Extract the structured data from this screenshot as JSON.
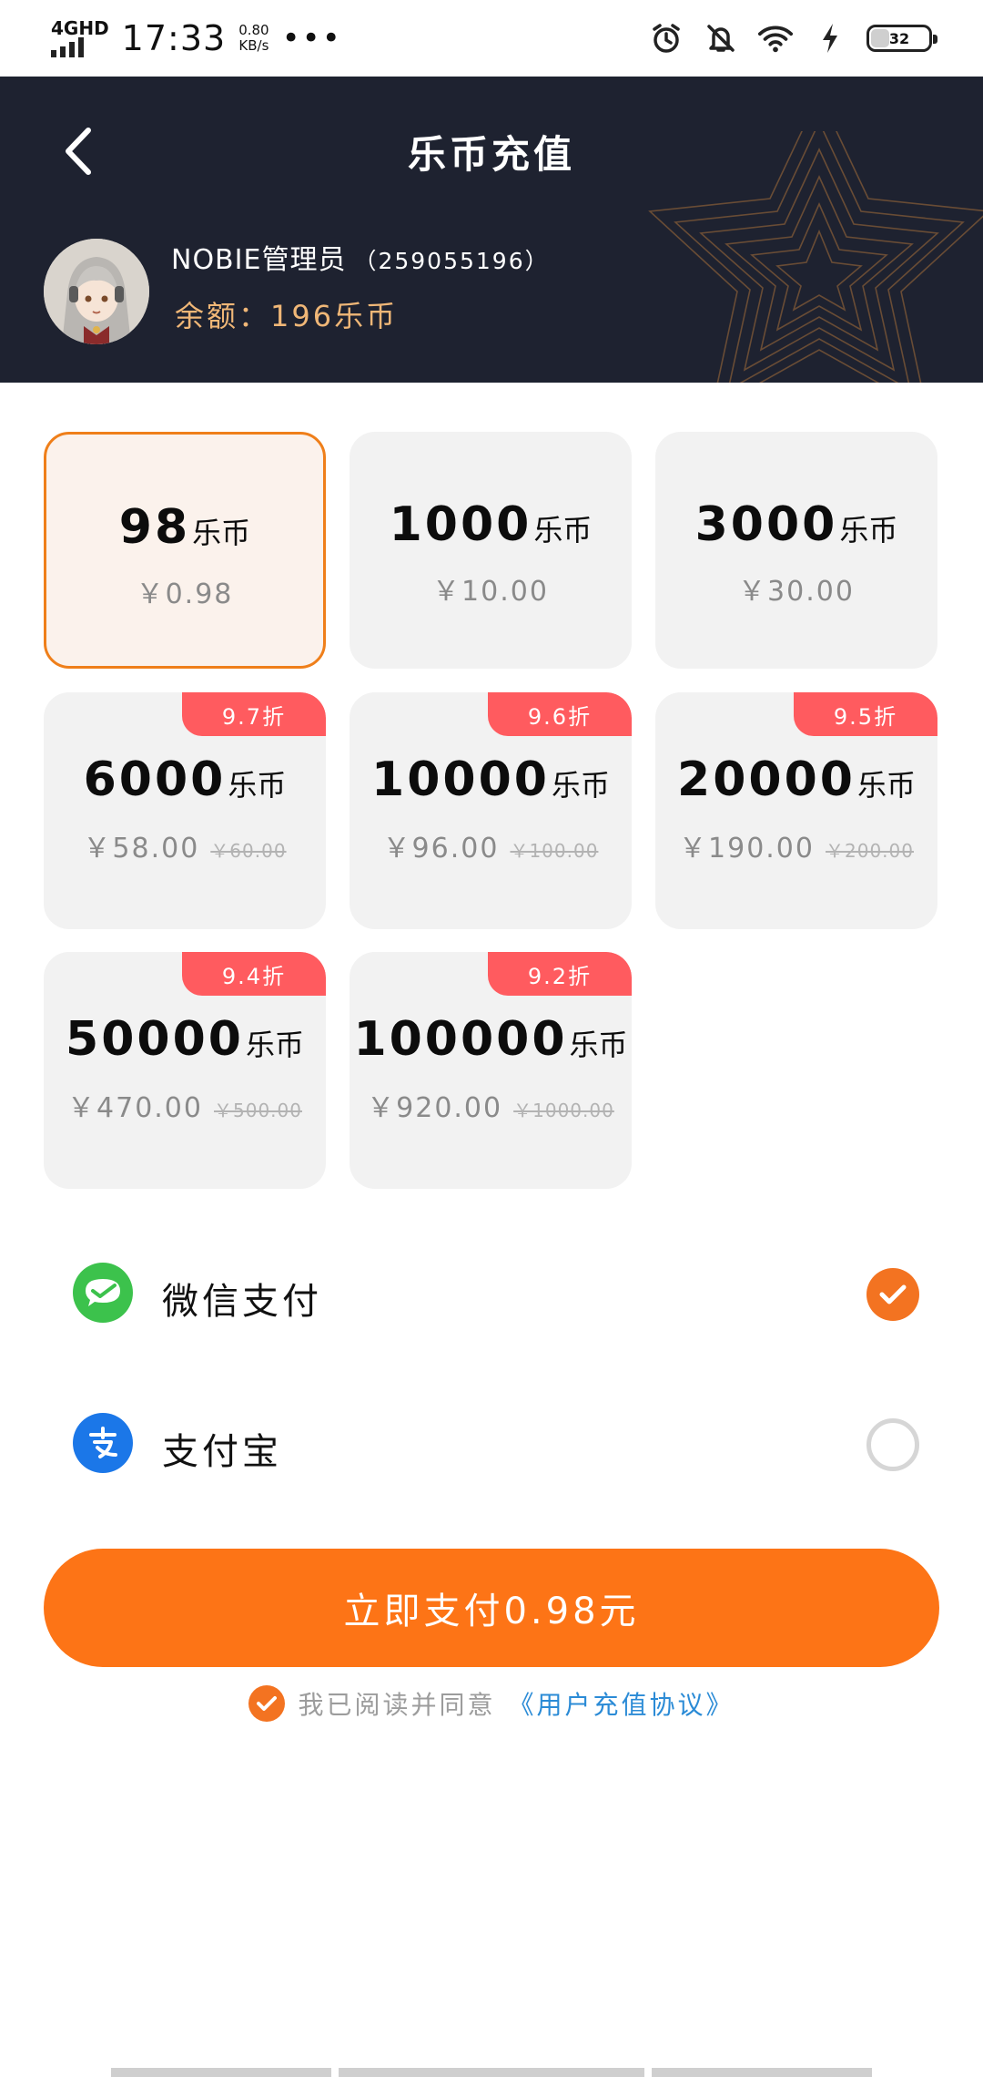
{
  "status_bar": {
    "network": "4GHD",
    "time": "17:33",
    "speed_value": "0.80",
    "speed_unit": "KB/s",
    "more": "•••",
    "battery": "32",
    "icons": [
      "alarm-icon",
      "mute-icon",
      "wifi-icon",
      "charging-icon",
      "battery-icon"
    ]
  },
  "header": {
    "title": "乐币充值",
    "back_icon": "back-arrow-icon",
    "user_name": "NOBIE管理员",
    "user_id": "（259055196）",
    "balance": "余额：196乐币",
    "avatar": "anime-girl-avatar"
  },
  "packages": [
    {
      "amount": "98",
      "unit": "乐币",
      "price": "￥0.98",
      "original": "",
      "badge": "",
      "selected": true
    },
    {
      "amount": "1000",
      "unit": "乐币",
      "price": "￥10.00",
      "original": "",
      "badge": "",
      "selected": false
    },
    {
      "amount": "3000",
      "unit": "乐币",
      "price": "￥30.00",
      "original": "",
      "badge": "",
      "selected": false
    },
    {
      "amount": "6000",
      "unit": "乐币",
      "price": "￥58.00",
      "original": "￥60.00",
      "badge": "9.7折",
      "selected": false
    },
    {
      "amount": "10000",
      "unit": "乐币",
      "price": "￥96.00",
      "original": "￥100.00",
      "badge": "9.6折",
      "selected": false
    },
    {
      "amount": "20000",
      "unit": "乐币",
      "price": "￥190.00",
      "original": "￥200.00",
      "badge": "9.5折",
      "selected": false
    },
    {
      "amount": "50000",
      "unit": "乐币",
      "price": "￥470.00",
      "original": "￥500.00",
      "badge": "9.4折",
      "selected": false
    },
    {
      "amount": "100000",
      "unit": "乐币",
      "price": "￥920.00",
      "original": "￥1000.00",
      "badge": "9.2折",
      "selected": false
    }
  ],
  "payment": {
    "wechat": {
      "label": "微信支付",
      "icon": "wechat-pay-icon",
      "selected": true
    },
    "alipay": {
      "label": "支付宝",
      "icon": "alipay-icon",
      "selected": false
    }
  },
  "pay_button": "立即支付0.98元",
  "agreement": {
    "text": "我已阅读并同意",
    "link": "《用户充值协议》",
    "checked": true
  },
  "colors": {
    "accent": "#fd7416",
    "header_bg": "#1e2230",
    "balance": "#f0b777",
    "badge": "#ff5b5f",
    "link": "#2b8bd6",
    "wechat": "#3cc24c",
    "alipay": "#1b77e8"
  }
}
